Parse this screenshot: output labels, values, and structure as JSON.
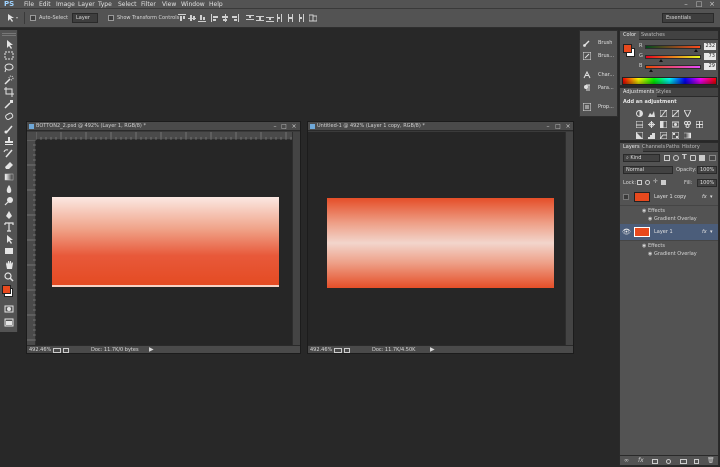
{
  "app": {
    "logo": "PS"
  },
  "menu": [
    "File",
    "Edit",
    "Image",
    "Layer",
    "Type",
    "Select",
    "Filter",
    "View",
    "Window",
    "Help"
  ],
  "window_controls": {
    "minimize": "–",
    "maximize": "□",
    "close": "×"
  },
  "options_bar": {
    "auto_select_label": "Auto-Select",
    "auto_select_target": "Layer",
    "show_transform_label": "Show Transform Controls",
    "workspace": "Essentials"
  },
  "documents": [
    {
      "title": "BOTTON2_2.psd @ 492% (Layer 1, RGB/8) *",
      "zoom": "492.46%",
      "doc_info": "Doc: 11.7K/0 bytes",
      "gradient_stops": [
        "#fbe8e2",
        "#f0a48a",
        "#e8593a",
        "#e44a21"
      ]
    },
    {
      "title": "Untitled-1 @ 492% (Layer 1 copy, RGB/8) *",
      "zoom": "492.46%",
      "doc_info": "Doc: 11.7K/4.50K",
      "gradient_stops": [
        "#e54e28",
        "#eea088",
        "#f2d5cc",
        "#eea088",
        "#e54e28"
      ]
    }
  ],
  "dock_items": [
    {
      "label": "Brush",
      "icon": "brush-icon"
    },
    {
      "label": "Brus...",
      "icon": "brush-presets-icon"
    },
    {
      "label": "Char...",
      "icon": "character-icon"
    },
    {
      "label": "Para...",
      "icon": "paragraph-icon"
    },
    {
      "label": "Prop...",
      "icon": "properties-icon"
    }
  ],
  "color_panel": {
    "tabs": [
      "Color",
      "Swatches"
    ],
    "channels": [
      {
        "name": "R",
        "value": "232",
        "level": 0.91
      },
      {
        "name": "G",
        "value": "73",
        "level": 0.29
      },
      {
        "name": "B",
        "value": "29",
        "level": 0.11
      }
    ],
    "foreground": "#e8491d",
    "background": "#ffffff"
  },
  "adjustments_panel": {
    "tabs": [
      "Adjustments",
      "Styles"
    ],
    "heading": "Add an adjustment"
  },
  "layers_panel": {
    "tabs": [
      "Layers",
      "Channels",
      "Paths",
      "History"
    ],
    "filter_kind": "Kind",
    "blend_mode": "Normal",
    "opacity_label": "Opacity:",
    "opacity_value": "100%",
    "lock_label": "Lock:",
    "fill_label": "Fill:",
    "fill_value": "100%",
    "layers": [
      {
        "name": "Layer 1 copy",
        "fx": "fx",
        "effects": "Effects",
        "effect_name": "Gradient Overlay",
        "selected": false
      },
      {
        "name": "Layer 1",
        "fx": "fx",
        "effects": "Effects",
        "effect_name": "Gradient Overlay",
        "selected": true
      }
    ]
  },
  "colors": {
    "accent_orange": "#e8491d",
    "selection_blue": "#4b5d7a",
    "chrome": "#535353",
    "workspace": "#282828"
  }
}
